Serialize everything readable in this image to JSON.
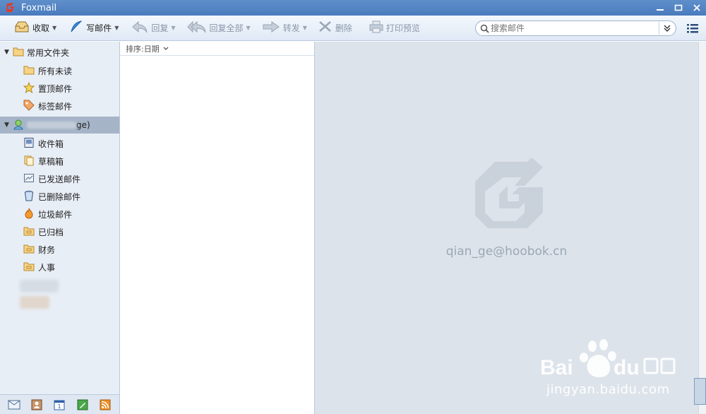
{
  "window": {
    "title": "Foxmail"
  },
  "toolbar": {
    "receive": "收取",
    "compose": "写邮件",
    "reply": "回复",
    "reply_all": "回复全部",
    "forward": "转发",
    "delete": "删除",
    "print_preview": "打印预览",
    "search_placeholder": "搜索邮件"
  },
  "sidebar": {
    "common_group": "常用文件夹",
    "common_items": [
      "所有未读",
      "置顶邮件",
      "标签邮件"
    ],
    "account_label_suffix": "ge)",
    "account_items": [
      "收件箱",
      "草稿箱",
      "已发送邮件",
      "已删除邮件",
      "垃圾邮件",
      "已归档",
      "财务",
      "人事"
    ]
  },
  "maillist": {
    "sort_label": "排序:日期"
  },
  "reading": {
    "account_email": "qian_ge@hoobok.cn"
  },
  "watermark": {
    "text": "jingyan.baidu.com"
  },
  "colors": {
    "titlebar": "#4a7bbd",
    "sidebar_bg": "#e8eef6",
    "reading_bg": "#dde3ea",
    "accent_red": "#e23a2b"
  }
}
